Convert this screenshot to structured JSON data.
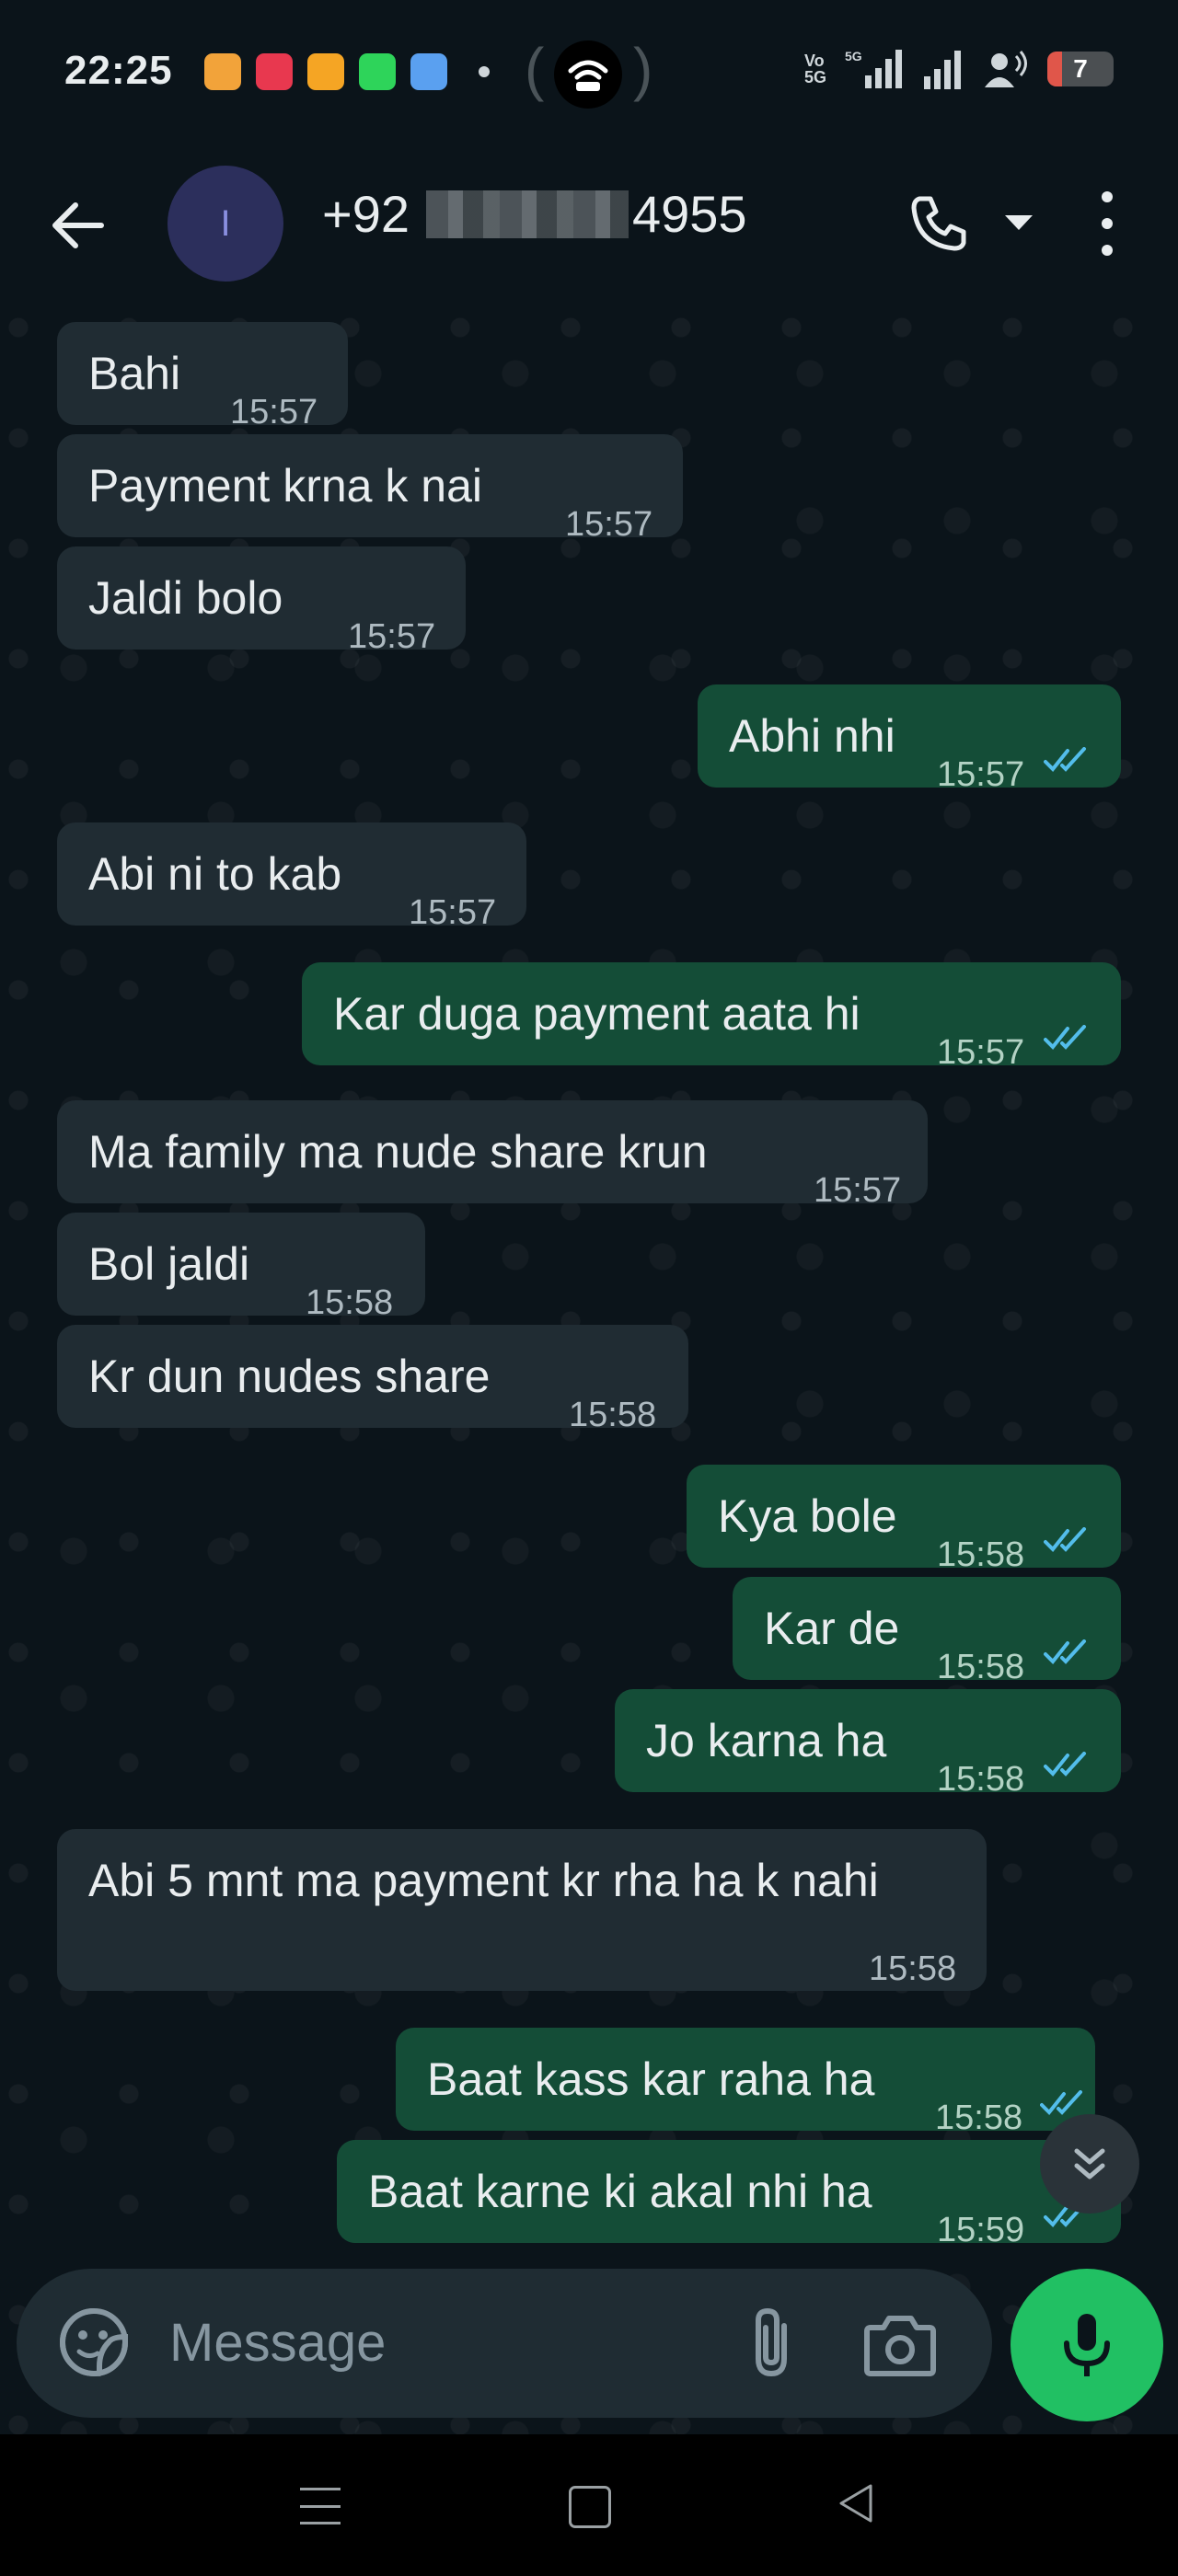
{
  "status_bar": {
    "time": "22:25",
    "battery": "7",
    "network_label": "5G",
    "app_icons": [
      "game-icon",
      "snapchat-icon",
      "orange-app-icon",
      "android-icon",
      "blue-app-icon"
    ]
  },
  "header": {
    "contact_prefix": "+92",
    "contact_suffix": "4955",
    "avatar_letter": "I"
  },
  "messages": [
    {
      "dir": "in",
      "text": "Bahi",
      "time": "15:57"
    },
    {
      "dir": "in",
      "text": "Payment krna k nai",
      "time": "15:57"
    },
    {
      "dir": "in",
      "text": "Jaldi bolo",
      "time": "15:57"
    },
    {
      "dir": "out",
      "text": "Abhi nhi",
      "time": "15:57",
      "read": true
    },
    {
      "dir": "in",
      "text": "Abi ni to kab",
      "time": "15:57"
    },
    {
      "dir": "out",
      "text": "Kar duga payment aata hi",
      "time": "15:57",
      "read": true
    },
    {
      "dir": "in",
      "text": "Ma family ma nude share krun",
      "time": "15:57"
    },
    {
      "dir": "in",
      "text": "Bol jaldi",
      "time": "15:58"
    },
    {
      "dir": "in",
      "text": "Kr dun nudes share",
      "time": "15:58"
    },
    {
      "dir": "out",
      "text": "Kya bole",
      "time": "15:58",
      "read": true
    },
    {
      "dir": "out",
      "text": "Kar de",
      "time": "15:58",
      "read": true
    },
    {
      "dir": "out",
      "text": "Jo karna ha",
      "time": "15:58",
      "read": true
    },
    {
      "dir": "in",
      "text": "Abi 5 mnt ma payment kr rha ha k nahi",
      "time": "15:58"
    },
    {
      "dir": "out",
      "text": "Baat kass kar raha ha",
      "time": "15:58",
      "read": true
    },
    {
      "dir": "out",
      "text": "Baat karne ki akal nhi ha",
      "time": "15:59",
      "read": true
    }
  ],
  "composer": {
    "placeholder": "Message"
  },
  "colors": {
    "incoming_bubble": "#202c33",
    "outgoing_bubble": "#144d37",
    "read_ticks": "#53bdeb",
    "accent_green": "#21c063",
    "background": "#0b141a"
  }
}
